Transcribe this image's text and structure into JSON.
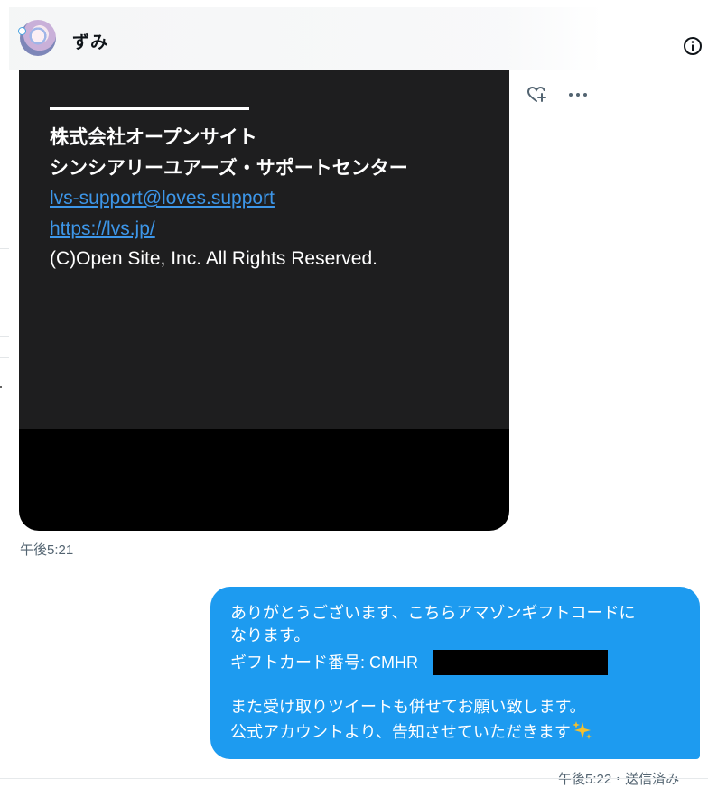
{
  "header": {
    "user_name": "ずみ"
  },
  "card": {
    "company": "株式会社オープンサイト",
    "center": "シンシアリーユアーズ・サポートセンター",
    "email": "lvs-support@loves.support",
    "url": "https://lvs.jp/",
    "copyright": "(C)Open Site, Inc. All Rights Reserved."
  },
  "messages": {
    "received_time": "午後5:21",
    "sent_line1": "ありがとうございます、こちらアマゾンギフトコードに",
    "sent_line2": "なります。",
    "sent_line3": "ギフトカード番号: CMHR",
    "sent_line4": "また受け取りツイートも併せてお願い致します。",
    "sent_line5": "公式アカウントより、告知させていただきます",
    "sent_status": "午後5:22・送信済み"
  },
  "icons": {
    "info": "info-icon",
    "react": "heart-plus-icon",
    "more": "more-icon",
    "sparkle": "sparkles-icon"
  },
  "colors": {
    "bubble": "#1d9bf0",
    "link": "#3d96e8",
    "card_bg": "#1e1e1f",
    "muted": "#536471"
  }
}
